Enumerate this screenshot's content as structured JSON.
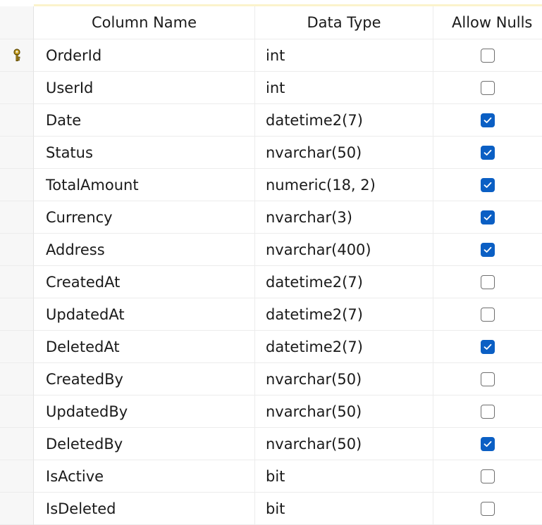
{
  "columns": {
    "column_name": "Column Name",
    "data_type": "Data Type",
    "allow_nulls": "Allow Nulls"
  },
  "primary_key_icon": "key-icon",
  "rows": [
    {
      "name": "OrderId",
      "type": "int",
      "allow_nulls": false,
      "primary_key": true
    },
    {
      "name": "UserId",
      "type": "int",
      "allow_nulls": false
    },
    {
      "name": "Date",
      "type": "datetime2(7)",
      "allow_nulls": true
    },
    {
      "name": "Status",
      "type": "nvarchar(50)",
      "allow_nulls": true
    },
    {
      "name": "TotalAmount",
      "type": "numeric(18, 2)",
      "allow_nulls": true
    },
    {
      "name": "Currency",
      "type": "nvarchar(3)",
      "allow_nulls": true
    },
    {
      "name": "Address",
      "type": "nvarchar(400)",
      "allow_nulls": true
    },
    {
      "name": "CreatedAt",
      "type": "datetime2(7)",
      "allow_nulls": false
    },
    {
      "name": "UpdatedAt",
      "type": "datetime2(7)",
      "allow_nulls": false
    },
    {
      "name": "DeletedAt",
      "type": "datetime2(7)",
      "allow_nulls": true
    },
    {
      "name": "CreatedBy",
      "type": "nvarchar(50)",
      "allow_nulls": false
    },
    {
      "name": "UpdatedBy",
      "type": "nvarchar(50)",
      "allow_nulls": false
    },
    {
      "name": "DeletedBy",
      "type": "nvarchar(50)",
      "allow_nulls": true
    },
    {
      "name": "IsActive",
      "type": "bit",
      "allow_nulls": false
    },
    {
      "name": "IsDeleted",
      "type": "bit",
      "allow_nulls": false
    }
  ],
  "colors": {
    "checkbox_checked": "#0b5fc4",
    "key_icon": "#c9a227",
    "header_accent": "#fbf3cc"
  }
}
